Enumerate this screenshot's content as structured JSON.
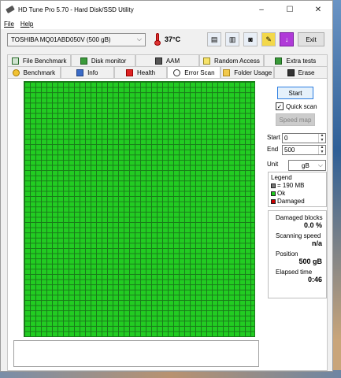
{
  "window": {
    "title": "HD Tune Pro 5.70 - Hard Disk/SSD Utility",
    "controls": {
      "minimize": "–",
      "maximize": "☐",
      "close": "✕"
    }
  },
  "menu": {
    "file": "File",
    "help": "Help"
  },
  "toolbar": {
    "drive": "TOSHIBA MQ01ABD050V (500 gB)",
    "temperature": "37°C",
    "exit_label": "Exit",
    "icons": [
      "copy-info-icon",
      "copy-screen-icon",
      "screenshot-icon",
      "options-icon",
      "save-icon"
    ]
  },
  "tabs": {
    "row1": [
      "File Benchmark",
      "Disk monitor",
      "AAM",
      "Random Access",
      "Extra tests"
    ],
    "row2": [
      "Benchmark",
      "Info",
      "Health",
      "Error Scan",
      "Folder Usage",
      "Erase"
    ],
    "active": "Error Scan"
  },
  "side": {
    "start_button": "Start",
    "quick_scan_label": "Quick scan",
    "quick_scan_checked": true,
    "speed_map_button": "Speed map",
    "start_label": "Start",
    "start_value": "0",
    "end_label": "End",
    "end_value": "500",
    "unit_label": "Unit",
    "unit_value": "gB"
  },
  "legend": {
    "title": "Legend",
    "block_size": "= 190 MB",
    "ok": "Ok",
    "damaged": "Damaged",
    "colors": {
      "block": "#777777",
      "ok": "#22cc22",
      "damaged": "#cc0000"
    }
  },
  "stats": {
    "damaged_blocks_label": "Damaged blocks",
    "damaged_blocks_value": "0.0 %",
    "scanning_speed_label": "Scanning speed",
    "scanning_speed_value": "n/a",
    "position_label": "Position",
    "position_value": "500 gB",
    "elapsed_label": "Elapsed time",
    "elapsed_value": "0:46"
  },
  "scan_grid": {
    "status": "all blocks ok",
    "color": "#22cc22"
  }
}
